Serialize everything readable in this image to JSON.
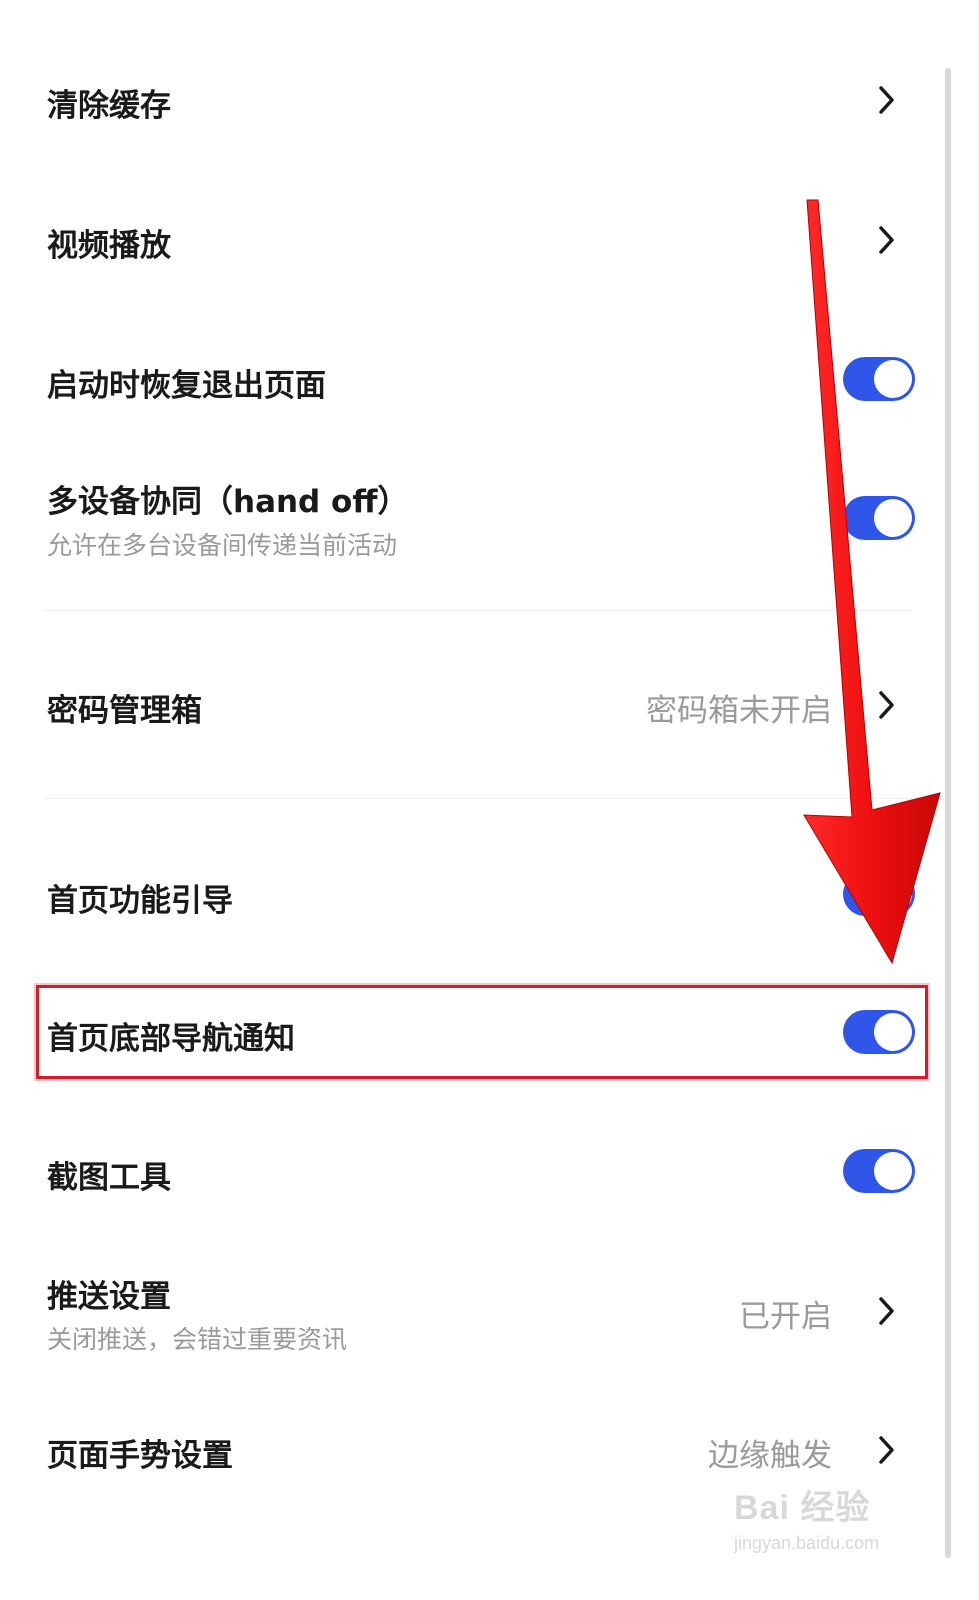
{
  "settings": {
    "clear_cache": {
      "label": "清除缓存"
    },
    "video_playback": {
      "label": "视频播放"
    },
    "restore_on_launch": {
      "label": "启动时恢复退出页面",
      "enabled": true
    },
    "handoff": {
      "label": "多设备协同（hand off）",
      "sublabel": "允许在多台设备间传递当前活动",
      "enabled": true
    },
    "password_manager": {
      "label": "密码管理箱",
      "value": "密码箱未开启"
    },
    "home_guide": {
      "label": "首页功能引导",
      "enabled": true
    },
    "home_nav_notify": {
      "label": "首页底部导航通知",
      "enabled": true
    },
    "screenshot_tool": {
      "label": "截图工具",
      "enabled": true
    },
    "push_settings": {
      "label": "推送设置",
      "sublabel": "关闭推送，会错过重要资讯",
      "value": "已开启"
    },
    "gesture_settings": {
      "label": "页面手势设置",
      "value": "边缘触发"
    }
  },
  "colors": {
    "toggle_on": "#2f56e8",
    "highlight": "#d21e26",
    "arrow": "#ee1111"
  },
  "icons": {
    "chevron": "chevron-right-icon",
    "arrow": "red-down-arrow"
  },
  "watermark": {
    "main": "Bai 经验",
    "sub": "jingyan.baidu.com"
  }
}
